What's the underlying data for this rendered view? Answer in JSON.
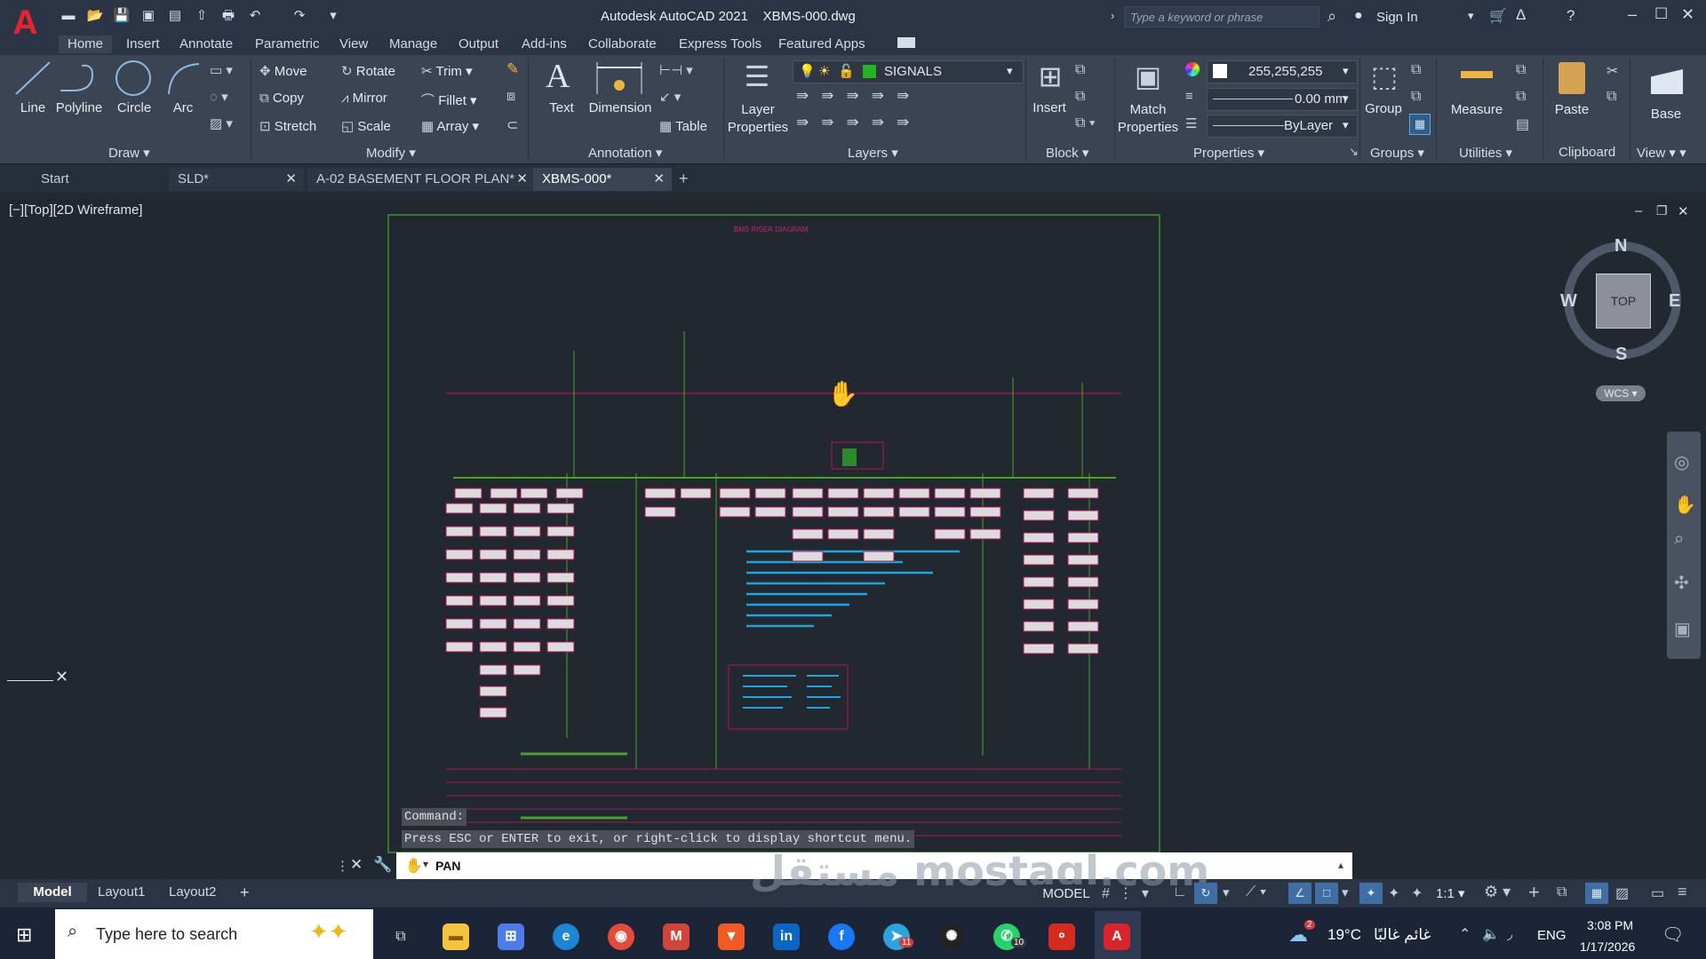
{
  "title_bar": {
    "app_title": "Autodesk AutoCAD 2021",
    "file_name": "XBMS-000.dwg",
    "search_placeholder": "Type a keyword or phrase",
    "sign_in": "Sign In"
  },
  "ribbon_tabs": [
    "Home",
    "Insert",
    "Annotate",
    "Parametric",
    "View",
    "Manage",
    "Output",
    "Add-ins",
    "Collaborate",
    "Express Tools",
    "Featured Apps"
  ],
  "draw": {
    "line": "Line",
    "polyline": "Polyline",
    "circle": "Circle",
    "arc": "Arc",
    "panel": "Draw"
  },
  "modify": {
    "move": "Move",
    "rotate": "Rotate",
    "trim": "Trim",
    "copy": "Copy",
    "mirror": "Mirror",
    "fillet": "Fillet",
    "stretch": "Stretch",
    "scale": "Scale",
    "array": "Array",
    "panel": "Modify"
  },
  "annotation": {
    "text": "Text",
    "dimension": "Dimension",
    "table": "Table",
    "panel": "Annotation"
  },
  "layers": {
    "layer_properties": "Layer Properties",
    "current_layer": "SIGNALS",
    "panel": "Layers"
  },
  "block": {
    "insert": "Insert",
    "panel": "Block"
  },
  "properties": {
    "match": "Match Properties",
    "color": "255,255,255",
    "lineweight": "0.00 mm",
    "linetype": "ByLayer",
    "panel": "Properties"
  },
  "groups": {
    "group": "Group",
    "panel": "Groups"
  },
  "utilities": {
    "measure": "Measure",
    "panel": "Utilities"
  },
  "clipboard": {
    "paste": "Paste",
    "panel": "Clipboard"
  },
  "view_panel": {
    "base": "Base",
    "panel": "View"
  },
  "doc_tabs": [
    "Start",
    "SLD*",
    "A-02 BASEMENT FLOOR PLAN*",
    "XBMS-000*"
  ],
  "viewport": {
    "label": "[−][Top][2D Wireframe]",
    "drawing_title": "BMS RISER DIAGRAM",
    "compass": {
      "n": "N",
      "s": "S",
      "e": "E",
      "w": "W",
      "top": "TOP",
      "wcs": "WCS"
    }
  },
  "command": {
    "history_label": "Command:",
    "history_message": "Press ESC or ENTER to exit, or right-click to display shortcut menu.",
    "input_value": "PAN"
  },
  "layout_tabs": [
    "Model",
    "Layout1",
    "Layout2"
  ],
  "status": {
    "model": "MODEL",
    "scale": "1:1"
  },
  "watermark": "مستقل mostaql.com",
  "taskbar": {
    "search_placeholder": "Type here to search",
    "weather_temp": "19°C",
    "weather_desc": "غائم غالبًا",
    "weather_badge": "2",
    "language": "ENG",
    "time": "3:08 PM",
    "date": "1/17/2026",
    "badges": {
      "telegram": "11",
      "whatsapp": "10"
    }
  }
}
